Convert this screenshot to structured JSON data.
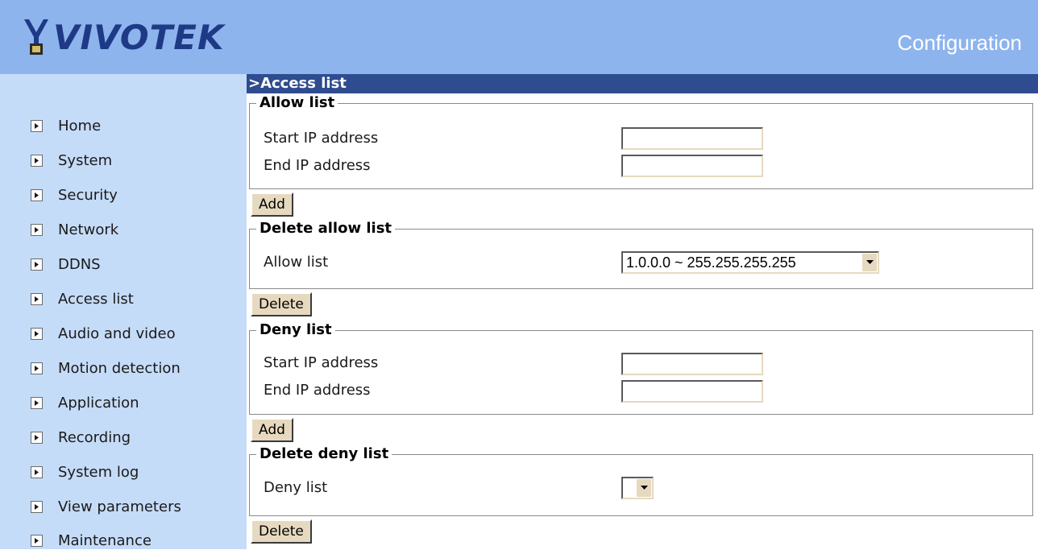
{
  "header": {
    "logo_text": "VIVOTEK",
    "title": "Configuration"
  },
  "colors": {
    "header_bg": "#8db4ec",
    "sidebar_bg": "#c5dcf8",
    "section_bar": "#2e4c8f",
    "button_face": "#e6d9bf",
    "logo_color": "#1e3a86"
  },
  "sidebar": {
    "items": [
      {
        "label": "Home",
        "icon": "arrow-right-icon"
      },
      {
        "label": "System",
        "icon": "arrow-right-icon"
      },
      {
        "label": "Security",
        "icon": "arrow-right-icon"
      },
      {
        "label": "Network",
        "icon": "arrow-right-icon"
      },
      {
        "label": "DDNS",
        "icon": "arrow-right-icon"
      },
      {
        "label": "Access list",
        "icon": "arrow-right-icon"
      },
      {
        "label": "Audio and video",
        "icon": "arrow-right-icon"
      },
      {
        "label": "Motion detection",
        "icon": "arrow-right-icon"
      },
      {
        "label": "Application",
        "icon": "arrow-right-icon"
      },
      {
        "label": "Recording",
        "icon": "arrow-right-icon"
      },
      {
        "label": "System log",
        "icon": "arrow-right-icon"
      },
      {
        "label": "View parameters",
        "icon": "arrow-right-icon"
      },
      {
        "label": "Maintenance",
        "icon": "arrow-right-icon"
      }
    ]
  },
  "main": {
    "section_title": ">Access list",
    "allow": {
      "legend": "Allow list",
      "start_label": "Start IP address",
      "start_value": "",
      "end_label": "End IP address",
      "end_value": "",
      "add_label": "Add"
    },
    "delete_allow": {
      "legend": "Delete allow list",
      "label": "Allow list",
      "selected": "1.0.0.0 ~ 255.255.255.255",
      "delete_label": "Delete"
    },
    "deny": {
      "legend": "Deny list",
      "start_label": "Start IP address",
      "start_value": "",
      "end_label": "End IP address",
      "end_value": "",
      "add_label": "Add"
    },
    "delete_deny": {
      "legend": "Delete deny list",
      "label": "Deny list",
      "selected": "",
      "delete_label": "Delete"
    }
  }
}
